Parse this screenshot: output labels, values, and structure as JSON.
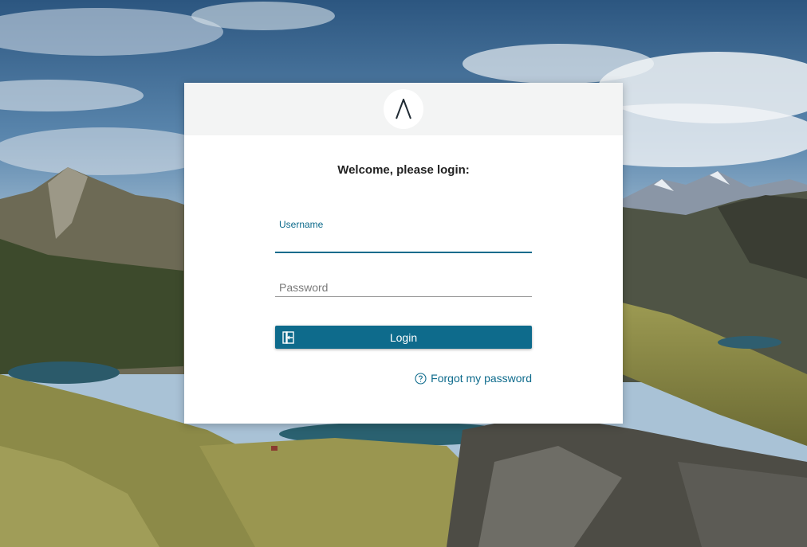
{
  "background": {
    "icon": "mountain-landscape-photo"
  },
  "header": {
    "logo_icon": "lambda-logo-icon"
  },
  "form": {
    "welcome": "Welcome, please login:",
    "username": {
      "label": "Username",
      "value": ""
    },
    "password": {
      "placeholder": "Password",
      "value": ""
    },
    "login_label": "Login",
    "login_icon": "login-door-icon",
    "forgot_label": "Forgot my password",
    "forgot_icon": "help-circle-icon"
  },
  "colors": {
    "accent": "#0e6b8c",
    "header_bg": "#f3f4f4",
    "card_bg": "#ffffff"
  }
}
